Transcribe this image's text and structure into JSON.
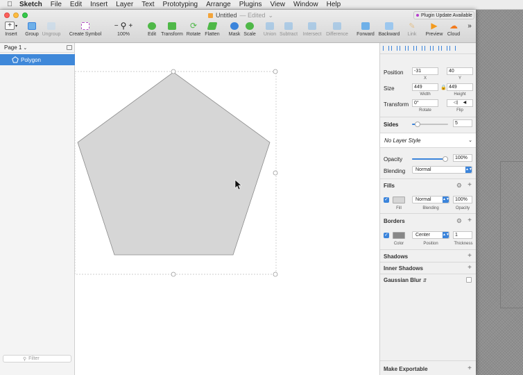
{
  "menubar": {
    "app": "Sketch",
    "items": [
      "File",
      "Edit",
      "Insert",
      "Layer",
      "Text",
      "Prototyping",
      "Arrange",
      "Plugins",
      "View",
      "Window",
      "Help"
    ]
  },
  "window": {
    "title": "Untitled",
    "edited": "— Edited",
    "plugin_badge": "Plugin Update Available"
  },
  "toolbar": {
    "insert": "Insert",
    "group": "Group",
    "ungroup": "Ungroup",
    "create_symbol": "Create Symbol",
    "zoom": "100%",
    "edit": "Edit",
    "transform": "Transform",
    "rotate": "Rotate",
    "flatten": "Flatten",
    "mask": "Mask",
    "scale": "Scale",
    "union": "Union",
    "subtract": "Subtract",
    "intersect": "Intersect",
    "difference": "Difference",
    "forward": "Forward",
    "backward": "Backward",
    "link": "Link",
    "preview": "Preview",
    "cloud": "Cloud"
  },
  "layers": {
    "page": "Page 1",
    "items": [
      {
        "name": "Polygon"
      }
    ],
    "filter_placeholder": "Filter"
  },
  "inspector": {
    "position": {
      "label": "Position",
      "x": "-31",
      "y": "40",
      "x_label": "X",
      "y_label": "Y"
    },
    "size": {
      "label": "Size",
      "width": "449",
      "height": "449",
      "width_label": "Width",
      "height_label": "Height"
    },
    "transform": {
      "label": "Transform",
      "rotate": "0°",
      "rotate_label": "Rotate",
      "flip_label": "Flip"
    },
    "sides": {
      "label": "Sides",
      "value": "5",
      "level": 0.15
    },
    "layer_style": "No Layer Style",
    "opacity": {
      "label": "Opacity",
      "value": "100%",
      "level": 1.0
    },
    "blending": {
      "label": "Blending",
      "value": "Normal"
    },
    "fills": {
      "title": "Fills",
      "blending": "Normal",
      "opacity": "100%",
      "fill_label": "Fill",
      "blending_label": "Blending",
      "opacity_label": "Opacity",
      "color": "#d6d6d6"
    },
    "borders": {
      "title": "Borders",
      "position": "Center",
      "thickness": "1",
      "color_label": "Color",
      "position_label": "Position",
      "thickness_label": "Thickness",
      "color": "#888888"
    },
    "shadows": "Shadows",
    "inner_shadows": "Inner Shadows",
    "gaussian_blur": "Gaussian Blur",
    "make_exportable": "Make Exportable"
  },
  "colors": {
    "accent": "#3f88d9",
    "polygon_fill": "#d6d6d6",
    "polygon_stroke": "#8a8a8a"
  }
}
